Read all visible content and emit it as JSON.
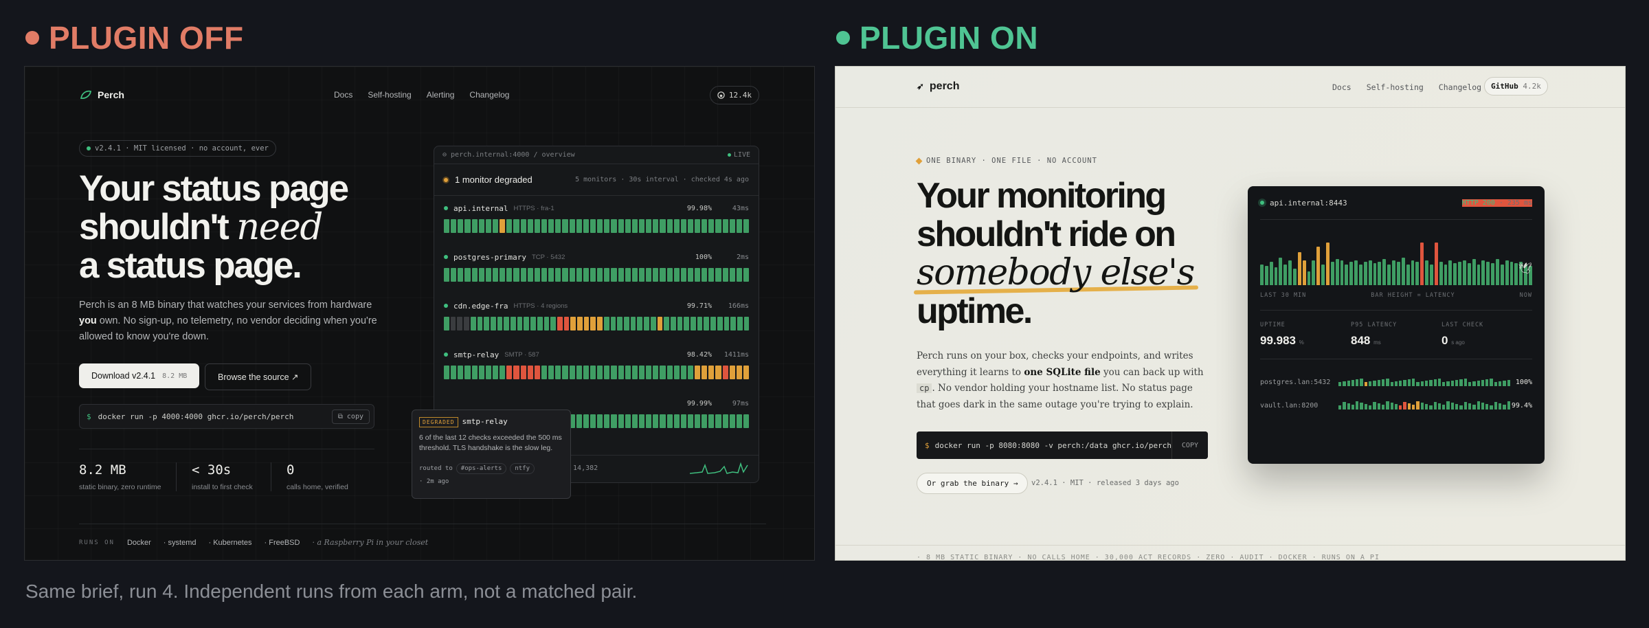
{
  "labels": {
    "off": "PLUGIN OFF",
    "on": "PLUGIN ON",
    "off_color": "#e17c66",
    "on_color": "#4fc493"
  },
  "caption": "Same brief, run 4. Independent runs from each arm, not a matched pair.",
  "left": {
    "brand": "Perch",
    "nav": [
      "Docs",
      "Self-hosting",
      "Alerting",
      "Changelog"
    ],
    "github": "12.4k",
    "version": "v2.4.1 · MIT licensed · no account, ever",
    "h1a": "Your status page",
    "h1b": "shouldn't ",
    "h1c": "need",
    "h1d": "a status page.",
    "desc_a": "Perch is an 8 MB binary that watches your services from hardware ",
    "desc_b": "you",
    " desc_c": "",
    "desc_c2": " own. No sign-up, no telemetry, no vendor deciding when you're allowed to know you're down.",
    "download": "Download v2.4.1",
    "download_size": "8.2 MB",
    "browse": "Browse the source ↗",
    "cmd": "docker run -p 4000:4000 ghcr.io/perch/perch",
    "copy": "copy",
    "stats": [
      {
        "n": "8.2 MB",
        "l": "static binary, zero runtime"
      },
      {
        "n": "< 30s",
        "l": "install to first check"
      },
      {
        "n": "0",
        "l": "calls home, verified"
      }
    ],
    "runs_label": "RUNS ON",
    "runs": [
      "Docker",
      "systemd",
      "Kubernetes",
      "FreeBSD"
    ],
    "runs_note": "a Raspberry Pi in your closet",
    "dash": {
      "url": "perch.internal:4000 / overview",
      "live": "LIVE",
      "status": "1 monitor degraded",
      "meta": "5 monitors · 30s interval · checked 4s ago",
      "monitors": [
        {
          "name": "api.internal",
          "kind": "HTTPS · fra-1",
          "pct": "99.98%",
          "ms": "43ms",
          "bars": "ggggggggoggggggggggggggggggggggggggggggggggg"
        },
        {
          "name": "postgres-primary",
          "kind": "TCP · 5432",
          "pct": "100%",
          "ms": "2ms",
          "bars": "gggggggggggggggggggggggggggggggggggggggggggg"
        },
        {
          "name": "cdn.edge-fra",
          "kind": "HTTPS · 4 regions",
          "pct": "99.71%",
          "ms": "166ms",
          "bars": "gdddgggggggggggggrroooooggggggggoggggggggggggg"
        },
        {
          "name": "smtp-relay",
          "kind": "SMTP · 587",
          "pct": "98.42%",
          "ms": "1411ms",
          "bars": "gggggggggrrrrrggggggggggggggggggggggoooorooo"
        },
        {
          "name": "",
          "kind": "",
          "pct": "99.99%",
          "ms": "97ms",
          "bars": "gggggggggggggggggggggggggggggggggggggggggggg"
        }
      ],
      "footer": "y 14,382"
    },
    "tip": {
      "badge": "DEGRADED",
      "title": "smtp-relay",
      "body": "6 of the last 12 checks exceeded the 500 ms threshold. TLS handshake is the slow leg.",
      "routed": "routed to",
      "r1": "#ops-alerts",
      "r2": "ntfy",
      "ago": "· 2m ago"
    }
  },
  "right": {
    "brand": "perch",
    "nav": [
      "Docs",
      "Self-hosting",
      "Changelog"
    ],
    "github": "GitHub",
    "stars": "4.2k",
    "eyebrow": "ONE BINARY · ONE FILE · NO ACCOUNT",
    "h1a": "Your monitoring",
    "h1b": "shouldn't ride on",
    "h1c": "somebody else's",
    "h1d": "uptime.",
    "desc_a": "Perch runs on your box, checks your endpoints, and writes everything it learns to ",
    "desc_b": "one SQLite file",
    "desc_c": " you can back up with ",
    "desc_code": "cp",
    "desc_d": ". No vendor holding your hostname list. No status page that goes dark in the same outage you're trying to explain.",
    "cmd": "docker run -p 8080:8080 -v perch:/data ghcr.io/perch/pe",
    "copy": "COPY",
    "grab": "Or grab the binary →",
    "release": "v2.4.1 · MIT · released 3 days ago",
    "card": {
      "host": "api.internal:8443",
      "http": "HTTP 200",
      "lat": " · 235 ms",
      "ax": [
        "LAST 30 MIN",
        "BAR HEIGHT = LATENCY",
        "NOW"
      ],
      "kpis": [
        {
          "l": "UPTIME",
          "v": "99.983",
          "u": "%"
        },
        {
          "l": "P95 LATENCY",
          "v": "848",
          "u": "ms"
        },
        {
          "l": "LAST CHECK",
          "v": "0",
          "u": "s ago"
        }
      ],
      "svcs": [
        {
          "n": "postgres.lan:5432",
          "p": "100%"
        },
        {
          "n": "vault.lan:8200",
          "p": "99.4%"
        }
      ]
    },
    "ticker": "· 8 MB STATIC BINARY · NO CALLS HOME · 30,000 ACT RECORDS · ZERO · AUDIT · DOCKER · RUNS ON A PI"
  }
}
